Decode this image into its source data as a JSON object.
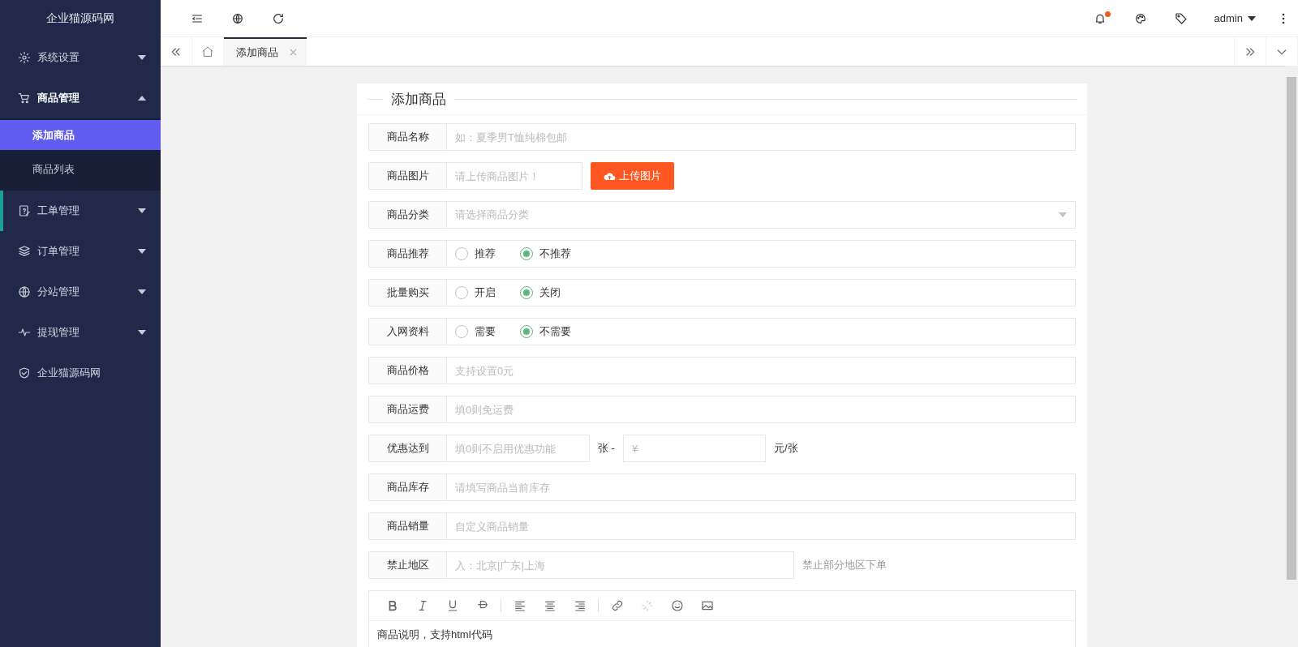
{
  "brand": "企业猫源码网",
  "sidebar": {
    "items": [
      {
        "label": "系统设置",
        "expanded": false,
        "highlighted": false
      },
      {
        "label": "商品管理",
        "expanded": true,
        "highlighted": false,
        "children": [
          {
            "label": "添加商品",
            "selected": true
          },
          {
            "label": "商品列表",
            "selected": false
          }
        ]
      },
      {
        "label": "工单管理",
        "expanded": false,
        "highlighted": true
      },
      {
        "label": "订单管理",
        "expanded": false,
        "highlighted": false
      },
      {
        "label": "分站管理",
        "expanded": false,
        "highlighted": false
      },
      {
        "label": "提现管理",
        "expanded": false,
        "highlighted": false
      },
      {
        "label": "企业猫源码网",
        "highlighted": false
      }
    ]
  },
  "topbar": {
    "notification": true,
    "user": "admin"
  },
  "tabs": [
    {
      "label": "添加商品",
      "selected": true
    }
  ],
  "form": {
    "title": "添加商品",
    "fields": [
      {
        "kind": "text",
        "label": "商品名称",
        "placeholder": "如：夏季男T恤纯棉包邮"
      },
      {
        "kind": "upload",
        "label": "商品图片",
        "placeholder": "请上传商品图片！",
        "button": "上传图片"
      },
      {
        "kind": "select",
        "label": "商品分类",
        "placeholder": "请选择商品分类"
      },
      {
        "kind": "radio",
        "label": "商品推荐",
        "options": [
          {
            "label": "推荐",
            "selected": false
          },
          {
            "label": "不推荐",
            "selected": true
          }
        ]
      },
      {
        "kind": "radio",
        "label": "批量购买",
        "options": [
          {
            "label": "开启",
            "selected": false
          },
          {
            "label": "关闭",
            "selected": true
          }
        ]
      },
      {
        "kind": "radio",
        "label": "入网资料",
        "options": [
          {
            "label": "需要",
            "selected": false
          },
          {
            "label": "不需要",
            "selected": true
          }
        ]
      },
      {
        "kind": "text",
        "label": "商品价格",
        "placeholder": "支持设置0元"
      },
      {
        "kind": "text",
        "label": "商品运费",
        "placeholder": "填0则免运费"
      },
      {
        "kind": "coupon",
        "label": "优惠达到",
        "placeholder": "填0则不启用优惠功能",
        "separator": "张 -",
        "placeholder2": "¥",
        "suffix": "元/张"
      },
      {
        "kind": "text",
        "label": "商品库存",
        "placeholder": "请填写商品当前库存"
      },
      {
        "kind": "text",
        "label": "商品销量",
        "placeholder": "自定义商品销量"
      },
      {
        "kind": "hint",
        "label": "禁止地区",
        "placeholder": "入：北京|广东|上海",
        "hint": "禁止部分地区下单"
      }
    ],
    "editor": {
      "content": "商品说明，支持html代码"
    }
  }
}
